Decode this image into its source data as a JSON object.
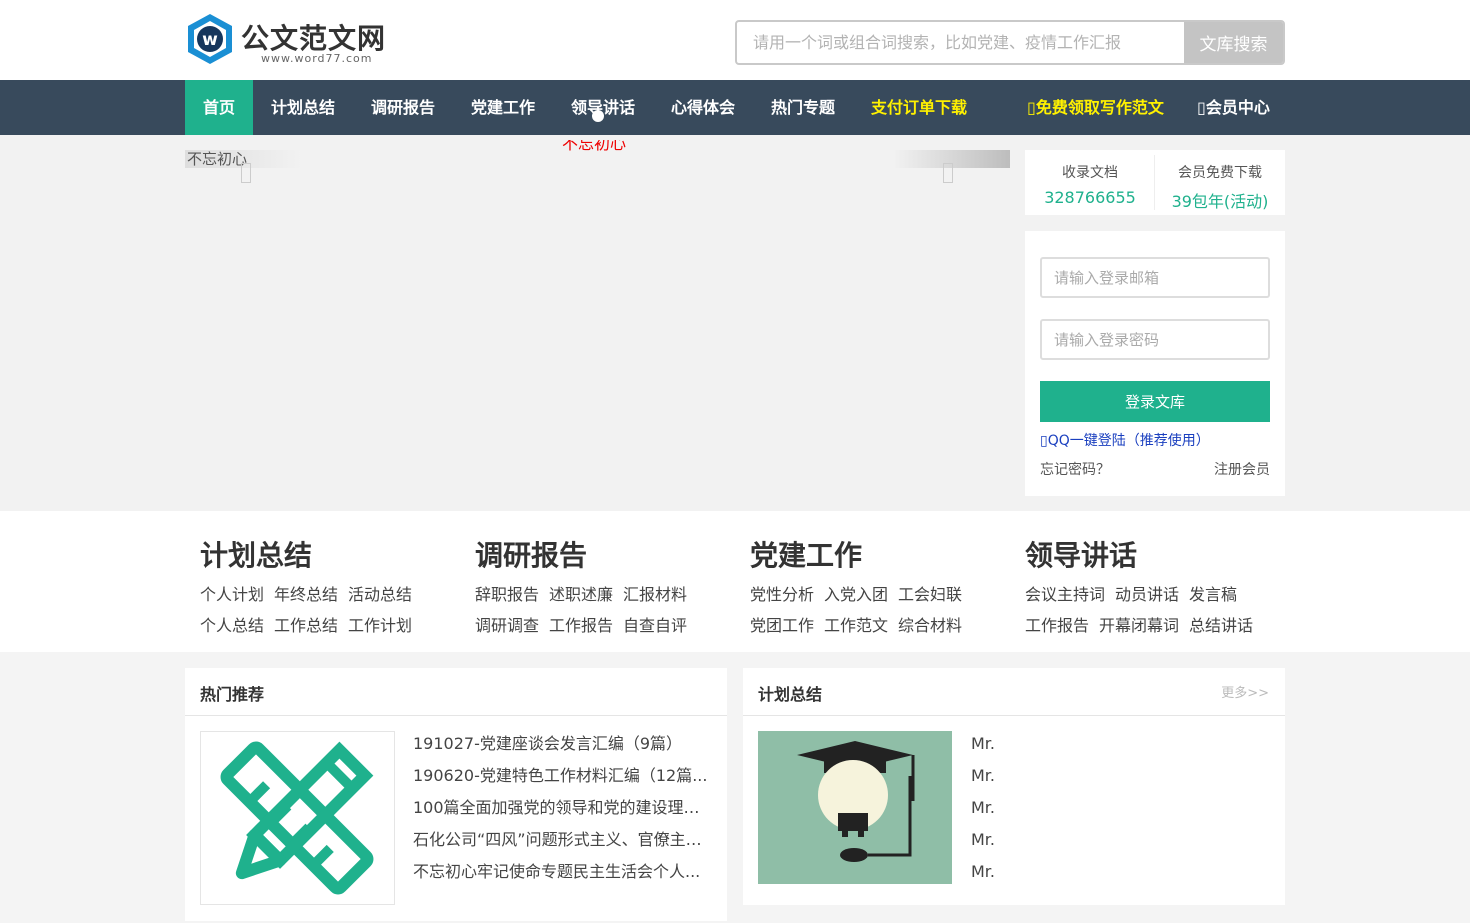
{
  "header": {
    "logo_title": "公文范文网",
    "logo_subtitle": "www.word77.com",
    "search_placeholder": "请用一个词或组合词搜索，比如党建、疫情工作汇报",
    "search_button": "文库搜索"
  },
  "nav": {
    "items": [
      {
        "label": "首页"
      },
      {
        "label": "计划总结"
      },
      {
        "label": "调研报告"
      },
      {
        "label": "党建工作"
      },
      {
        "label": "领导讲话"
      },
      {
        "label": "心得体会"
      },
      {
        "label": "热门专题"
      },
      {
        "label": "支付订单下载"
      },
      {
        "label": "免费领取写作范文"
      },
      {
        "label": "会员中心"
      }
    ]
  },
  "banner": {
    "image_alt": "不忘初心",
    "caption": "不忘初心"
  },
  "stats": {
    "docs_label": "收录文档",
    "docs_value": "328766655",
    "member_label": "会员免费下载",
    "member_value": "39包年(活动)"
  },
  "login": {
    "email_placeholder": "请输入登录邮箱",
    "password_placeholder": "请输入登录密码",
    "login_button": "登录文库",
    "qq_link": "QQ一键登陆（推荐使用）",
    "forgot": "忘记密码？",
    "register": "注册会员"
  },
  "categories": [
    {
      "title": "计划总结",
      "row1": [
        "个人计划",
        "年终总结",
        "活动总结"
      ],
      "row2": [
        "个人总结",
        "工作总结",
        "工作计划"
      ]
    },
    {
      "title": "调研报告",
      "row1": [
        "辞职报告",
        "述职述廉",
        "汇报材料"
      ],
      "row2": [
        "调研调查",
        "工作报告",
        "自查自评"
      ]
    },
    {
      "title": "党建工作",
      "row1": [
        "党性分析",
        "入党入团",
        "工会妇联"
      ],
      "row2": [
        "党团工作",
        "工作范文",
        "综合材料"
      ]
    },
    {
      "title": "领导讲话",
      "row1": [
        "会议主持词",
        "动员讲话",
        "发言稿"
      ],
      "row2": [
        "工作报告",
        "开幕闭幕词",
        "总结讲话"
      ]
    }
  ],
  "hot": {
    "title": "热门推荐",
    "items": [
      "191027-党建座谈会发言汇编（9篇）",
      "190620-党建特色工作材料汇编（12篇...",
      "100篇全面加强党的领导和党的建设理论...",
      "石化公司“四风”问题形式主义、官僚主义...",
      "不忘初心牢记使命专题民主生活会个人..."
    ]
  },
  "plan": {
    "title": "计划总结",
    "more": "更多>>",
    "items": [
      "Mr.",
      "Mr.",
      "Mr.",
      "Mr.",
      "Mr."
    ]
  }
}
